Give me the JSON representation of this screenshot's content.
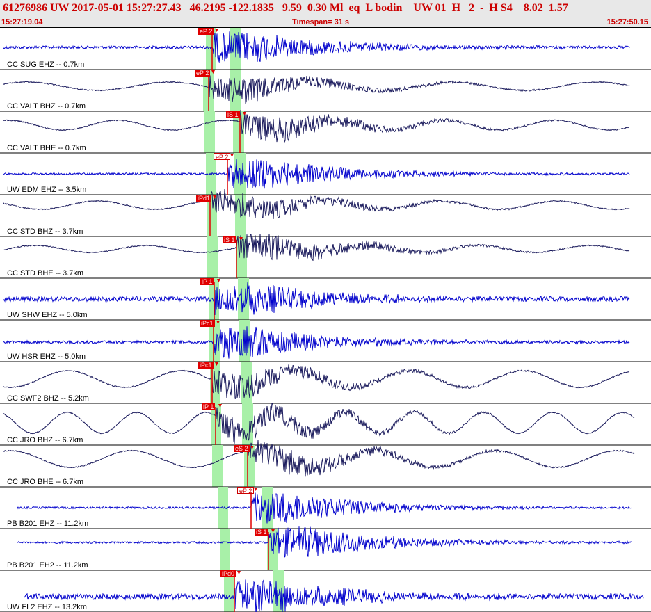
{
  "header": {
    "title": "61276986 UW 2017-05-01 15:27:27.43   46.2195 -122.1835   9.59  0.30 Ml  eq  L bodin    UW 01  H   2  -  H S4    8.02  1.57",
    "start_time": "15:27:19.04",
    "timespan": "Timespan=  31 s",
    "end_time": "15:27:50.15"
  },
  "colors": {
    "pick": "#e00000",
    "window": "#a8f0a8",
    "trace_blue": "#0000cc",
    "trace_dark": "#1a1a5c",
    "title": "#cc0000"
  },
  "traces": [
    {
      "label": "CC SUG EHZ -- 0.7km",
      "picks": [
        {
          "text": "eP 2",
          "style": "filled"
        }
      ]
    },
    {
      "label": "CC VALT BHZ -- 0.7km",
      "picks": [
        {
          "text": "eP 2",
          "style": "filled"
        }
      ]
    },
    {
      "label": "CC VALT BHE -- 0.7km",
      "picks": [
        {
          "text": "iS 1",
          "style": "filled"
        }
      ]
    },
    {
      "label": "UW EDM EHZ -- 3.5km",
      "picks": [
        {
          "text": "eP 2",
          "style": "outline"
        }
      ]
    },
    {
      "label": "CC STD BHZ -- 3.7km",
      "picks": [
        {
          "text": "iPd1",
          "style": "filled"
        }
      ]
    },
    {
      "label": "CC STD BHE -- 3.7km",
      "picks": [
        {
          "text": "iS 1",
          "style": "filled"
        }
      ]
    },
    {
      "label": "UW SHW EHZ -- 5.0km",
      "picks": [
        {
          "text": "iP 1",
          "style": "filled"
        }
      ]
    },
    {
      "label": "UW HSR EHZ -- 5.0km",
      "picks": [
        {
          "text": "iPc1",
          "style": "filled"
        }
      ]
    },
    {
      "label": "CC SWF2 BHZ -- 5.2km",
      "picks": [
        {
          "text": "iPc1",
          "style": "filled"
        }
      ]
    },
    {
      "label": "CC JRO BHZ -- 6.7km",
      "picks": [
        {
          "text": "iP 1",
          "style": "filled"
        }
      ]
    },
    {
      "label": "CC JRO BHE -- 6.7km",
      "picks": [
        {
          "text": "eS 2",
          "style": "filled"
        }
      ]
    },
    {
      "label": "PB B201 EHZ -- 11.2km",
      "picks": [
        {
          "text": "eP 2",
          "style": "outline"
        }
      ]
    },
    {
      "label": "PB B201 EH2 -- 11.2km",
      "picks": [
        {
          "text": "iS 1",
          "style": "filled"
        }
      ]
    },
    {
      "label": "UW FL2 EHZ -- 13.2km",
      "picks": [
        {
          "text": "iPd0",
          "style": "filled"
        }
      ]
    }
  ]
}
